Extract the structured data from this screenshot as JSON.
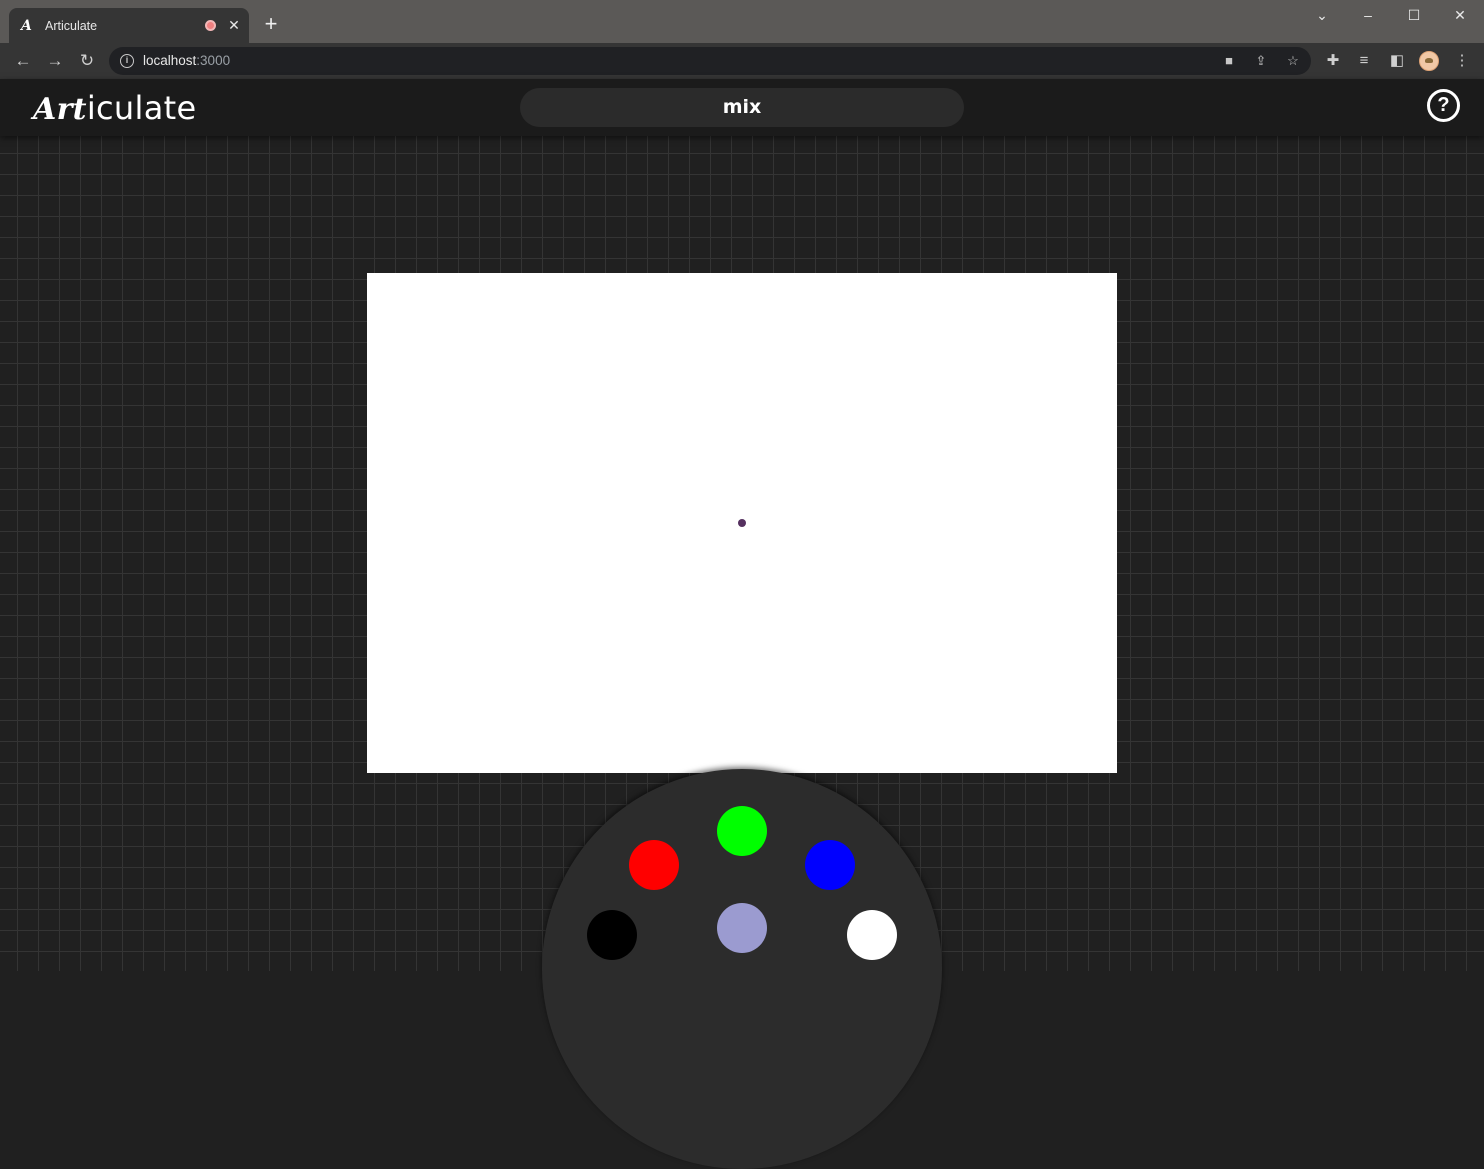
{
  "browser": {
    "tab_title": "Articulate",
    "tab_favicon": "A",
    "new_tab": "+",
    "url_host": "localhost",
    "url_port": ":3000"
  },
  "app": {
    "logo_art": "Art",
    "logo_rest": "iculate",
    "prompt_word": "mix",
    "help_label": "?"
  },
  "palette": {
    "swatches": [
      {
        "name": "red",
        "color": "#ff0000"
      },
      {
        "name": "green",
        "color": "#00ff00"
      },
      {
        "name": "blue",
        "color": "#0000ff"
      },
      {
        "name": "black",
        "color": "#000000"
      },
      {
        "name": "mix",
        "color": "#9b9bd0"
      },
      {
        "name": "white",
        "color": "#ffffff"
      }
    ]
  },
  "canvas": {
    "background": "#ffffff",
    "brush_color": "#55305f"
  }
}
